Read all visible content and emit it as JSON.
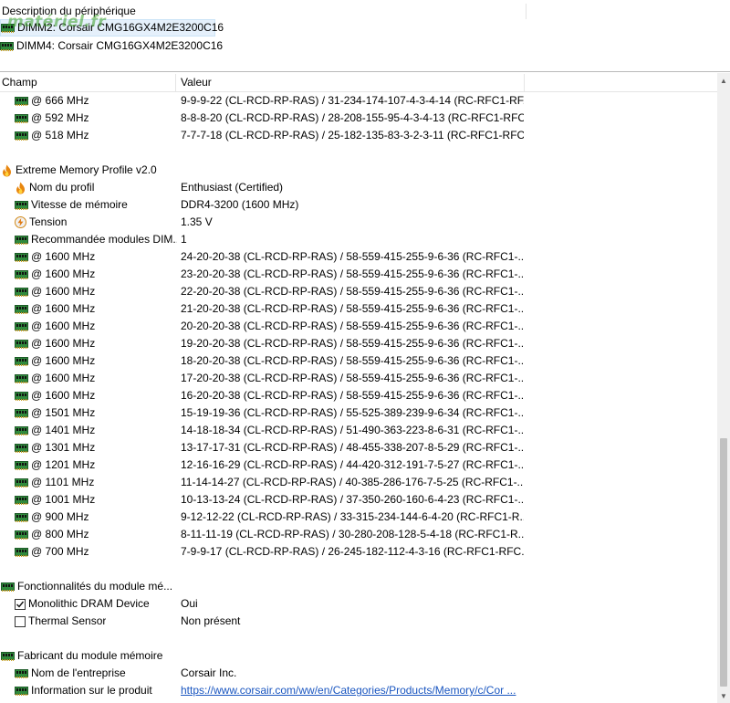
{
  "top_pane": {
    "header": "Description du périphérique",
    "devices": [
      {
        "label": "DIMM2: Corsair CMG16GX4M2E3200C16",
        "selected": true
      },
      {
        "label": "DIMM4: Corsair CMG16GX4M2E3200C16",
        "selected": false
      }
    ],
    "watermark": "matériel.fr"
  },
  "grid": {
    "col_champ": "Champ",
    "col_valeur": "Valeur"
  },
  "rows": [
    {
      "type": "item",
      "icon": "ram",
      "indent": 1,
      "field": "@ 666 MHz",
      "value": "9-9-9-22  (CL-RCD-RP-RAS) / 31-234-174-107-4-3-4-14  (RC-RFC1-RF..."
    },
    {
      "type": "item",
      "icon": "ram",
      "indent": 1,
      "field": "@ 592 MHz",
      "value": "8-8-8-20  (CL-RCD-RP-RAS) / 28-208-155-95-4-3-4-13  (RC-RFC1-RFC..."
    },
    {
      "type": "item",
      "icon": "ram",
      "indent": 1,
      "field": "@ 518 MHz",
      "value": "7-7-7-18  (CL-RCD-RP-RAS) / 25-182-135-83-3-2-3-11  (RC-RFC1-RFC..."
    },
    {
      "type": "blank"
    },
    {
      "type": "section",
      "icon": "flame",
      "indent": 0,
      "field": "Extreme Memory Profile v2.0",
      "value": ""
    },
    {
      "type": "item",
      "icon": "flame",
      "indent": 1,
      "field": "Nom du profil",
      "value": "Enthusiast (Certified)"
    },
    {
      "type": "item",
      "icon": "ram",
      "indent": 1,
      "field": "Vitesse de mémoire",
      "value": "DDR4-3200 (1600 MHz)"
    },
    {
      "type": "item",
      "icon": "bolt",
      "indent": 1,
      "field": "Tension",
      "value": "1.35 V"
    },
    {
      "type": "item",
      "icon": "ram",
      "indent": 1,
      "field": "Recommandée modules DIM...",
      "value": "1"
    },
    {
      "type": "item",
      "icon": "ram",
      "indent": 1,
      "field": "@ 1600 MHz",
      "value": "24-20-20-38  (CL-RCD-RP-RAS) / 58-559-415-255-9-6-36  (RC-RFC1-..."
    },
    {
      "type": "item",
      "icon": "ram",
      "indent": 1,
      "field": "@ 1600 MHz",
      "value": "23-20-20-38  (CL-RCD-RP-RAS) / 58-559-415-255-9-6-36  (RC-RFC1-..."
    },
    {
      "type": "item",
      "icon": "ram",
      "indent": 1,
      "field": "@ 1600 MHz",
      "value": "22-20-20-38  (CL-RCD-RP-RAS) / 58-559-415-255-9-6-36  (RC-RFC1-..."
    },
    {
      "type": "item",
      "icon": "ram",
      "indent": 1,
      "field": "@ 1600 MHz",
      "value": "21-20-20-38  (CL-RCD-RP-RAS) / 58-559-415-255-9-6-36  (RC-RFC1-..."
    },
    {
      "type": "item",
      "icon": "ram",
      "indent": 1,
      "field": "@ 1600 MHz",
      "value": "20-20-20-38  (CL-RCD-RP-RAS) / 58-559-415-255-9-6-36  (RC-RFC1-..."
    },
    {
      "type": "item",
      "icon": "ram",
      "indent": 1,
      "field": "@ 1600 MHz",
      "value": "19-20-20-38  (CL-RCD-RP-RAS) / 58-559-415-255-9-6-36  (RC-RFC1-..."
    },
    {
      "type": "item",
      "icon": "ram",
      "indent": 1,
      "field": "@ 1600 MHz",
      "value": "18-20-20-38  (CL-RCD-RP-RAS) / 58-559-415-255-9-6-36  (RC-RFC1-..."
    },
    {
      "type": "item",
      "icon": "ram",
      "indent": 1,
      "field": "@ 1600 MHz",
      "value": "17-20-20-38  (CL-RCD-RP-RAS) / 58-559-415-255-9-6-36  (RC-RFC1-..."
    },
    {
      "type": "item",
      "icon": "ram",
      "indent": 1,
      "field": "@ 1600 MHz",
      "value": "16-20-20-38  (CL-RCD-RP-RAS) / 58-559-415-255-9-6-36  (RC-RFC1-..."
    },
    {
      "type": "item",
      "icon": "ram",
      "indent": 1,
      "field": "@ 1501 MHz",
      "value": "15-19-19-36  (CL-RCD-RP-RAS) / 55-525-389-239-9-6-34  (RC-RFC1-..."
    },
    {
      "type": "item",
      "icon": "ram",
      "indent": 1,
      "field": "@ 1401 MHz",
      "value": "14-18-18-34  (CL-RCD-RP-RAS) / 51-490-363-223-8-6-31  (RC-RFC1-..."
    },
    {
      "type": "item",
      "icon": "ram",
      "indent": 1,
      "field": "@ 1301 MHz",
      "value": "13-17-17-31  (CL-RCD-RP-RAS) / 48-455-338-207-8-5-29  (RC-RFC1-..."
    },
    {
      "type": "item",
      "icon": "ram",
      "indent": 1,
      "field": "@ 1201 MHz",
      "value": "12-16-16-29  (CL-RCD-RP-RAS) / 44-420-312-191-7-5-27  (RC-RFC1-..."
    },
    {
      "type": "item",
      "icon": "ram",
      "indent": 1,
      "field": "@ 1101 MHz",
      "value": "11-14-14-27  (CL-RCD-RP-RAS) / 40-385-286-176-7-5-25  (RC-RFC1-..."
    },
    {
      "type": "item",
      "icon": "ram",
      "indent": 1,
      "field": "@ 1001 MHz",
      "value": "10-13-13-24  (CL-RCD-RP-RAS) / 37-350-260-160-6-4-23  (RC-RFC1-..."
    },
    {
      "type": "item",
      "icon": "ram",
      "indent": 1,
      "field": "@ 900 MHz",
      "value": "9-12-12-22  (CL-RCD-RP-RAS) / 33-315-234-144-6-4-20  (RC-RFC1-R..."
    },
    {
      "type": "item",
      "icon": "ram",
      "indent": 1,
      "field": "@ 800 MHz",
      "value": "8-11-11-19  (CL-RCD-RP-RAS) / 30-280-208-128-5-4-18  (RC-RFC1-R..."
    },
    {
      "type": "item",
      "icon": "ram",
      "indent": 1,
      "field": "@ 700 MHz",
      "value": "7-9-9-17  (CL-RCD-RP-RAS) / 26-245-182-112-4-3-16  (RC-RFC1-RFC..."
    },
    {
      "type": "blank"
    },
    {
      "type": "section",
      "icon": "ram",
      "indent": 0,
      "field": "Fonctionnalités du module mé...",
      "value": ""
    },
    {
      "type": "item",
      "icon": "checkbox-checked",
      "indent": 1,
      "field": "Monolithic DRAM Device",
      "value": "Oui"
    },
    {
      "type": "item",
      "icon": "checkbox-empty",
      "indent": 1,
      "field": "Thermal Sensor",
      "value": "Non présent"
    },
    {
      "type": "blank"
    },
    {
      "type": "section",
      "icon": "ram",
      "indent": 0,
      "field": "Fabricant du module mémoire",
      "value": ""
    },
    {
      "type": "item",
      "icon": "ram",
      "indent": 1,
      "field": "Nom de l'entreprise",
      "value": "Corsair Inc."
    },
    {
      "type": "item",
      "icon": "ram",
      "indent": 1,
      "field": "Information sur le produit",
      "value": "https://www.corsair.com/ww/en/Categories/Products/Memory/c/Cor ...",
      "link": true
    }
  ],
  "colors": {
    "ram_green": "#2f8a3c",
    "link_blue": "#1a56c0",
    "selection": "#e5f0fb",
    "flame": "#e8860f"
  }
}
